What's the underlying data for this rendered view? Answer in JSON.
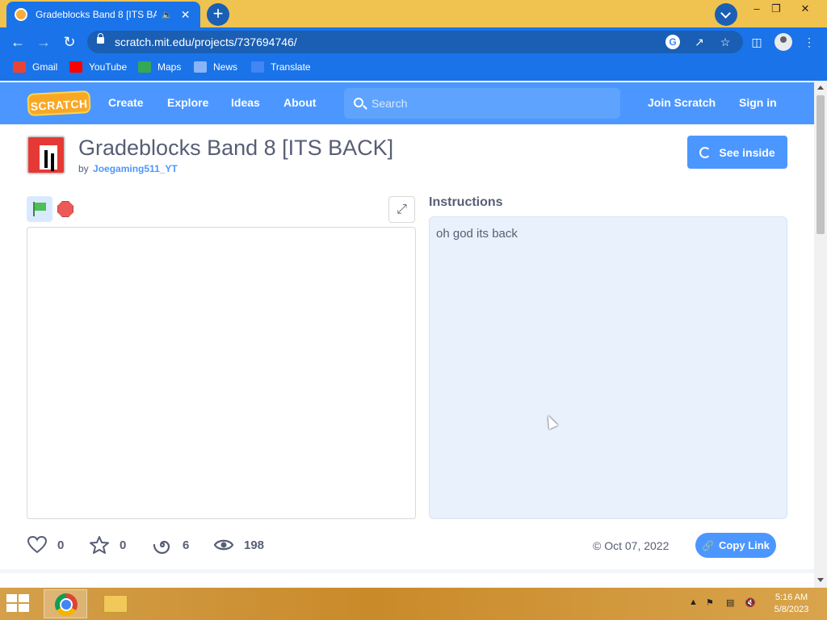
{
  "browser": {
    "tab_title": "Gradeblocks Band 8 [ITS BAC",
    "url": "scratch.mit.edu/projects/737694746/",
    "bookmarks": [
      "Gmail",
      "YouTube",
      "Maps",
      "News",
      "Translate"
    ]
  },
  "scratch_nav": {
    "logo": "SCRATCH",
    "links": [
      "Create",
      "Explore",
      "Ideas",
      "About"
    ],
    "search_placeholder": "Search",
    "join": "Join Scratch",
    "signin": "Sign in"
  },
  "project": {
    "title": "Gradeblocks Band 8 [ITS BACK]",
    "by": "by",
    "author": "Joegaming511_YT",
    "see_inside": "See inside",
    "instructions_heading": "Instructions",
    "instructions_text": "oh god its back",
    "stats": {
      "loves": "0",
      "favorites": "0",
      "remixes": "6",
      "views": "198"
    },
    "date": "Oct 07, 2022",
    "copy_link": "Copy Link"
  },
  "taskbar": {
    "time": "5:16 AM",
    "date": "5/8/2023"
  },
  "colors": {
    "scratch_blue": "#4c97ff",
    "chrome_blue": "#1a73e8",
    "text_gray": "#575e75"
  }
}
